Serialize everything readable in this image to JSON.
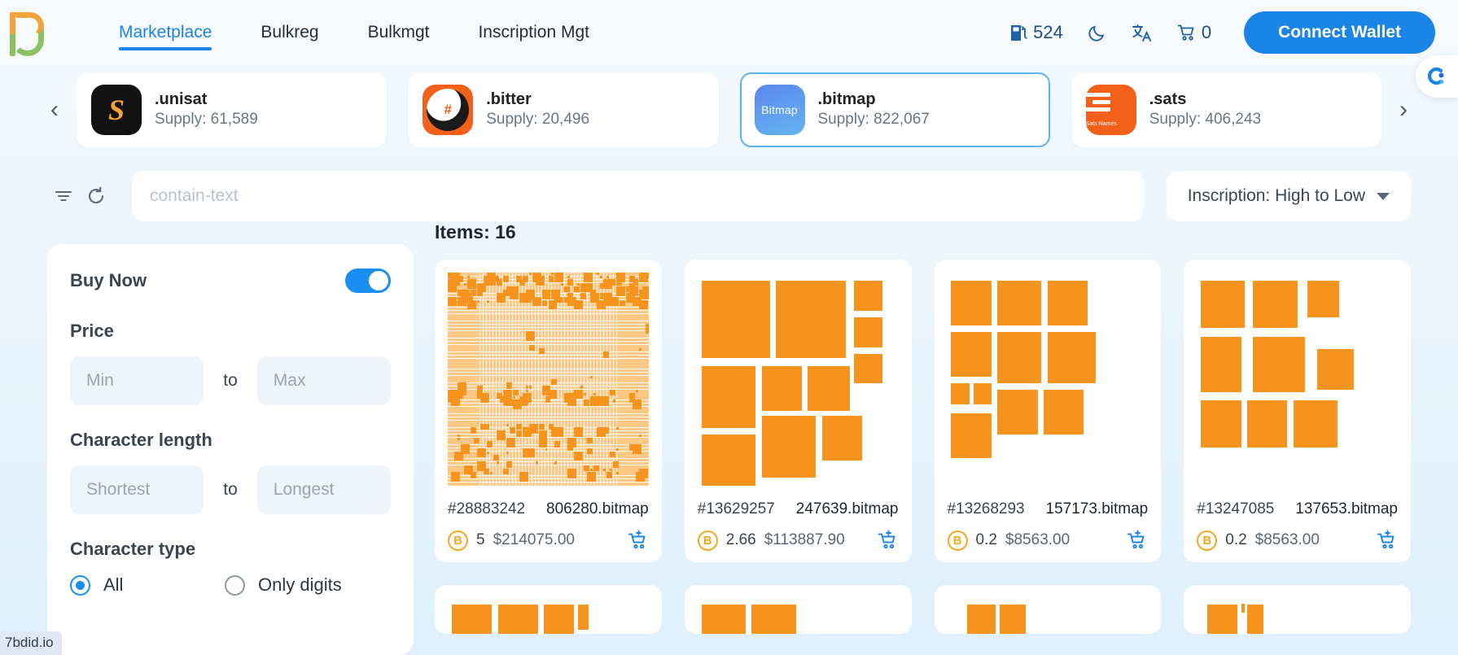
{
  "brand": {
    "logo_name": "bdid-logo"
  },
  "nav": {
    "items": [
      {
        "label": "Marketplace",
        "active": true
      },
      {
        "label": "Bulkreg",
        "active": false
      },
      {
        "label": "Bulkmgt",
        "active": false
      },
      {
        "label": "Inscription Mgt",
        "active": false
      }
    ]
  },
  "header_right": {
    "gas_icon": "gas-pump-icon",
    "gas_value": "524",
    "theme_icon": "moon-icon",
    "language_icon": "translate-icon",
    "cart_icon": "shopping-cart-icon",
    "cart_count": "0",
    "connect_label": "Connect Wallet"
  },
  "collections": {
    "prev_label": "‹",
    "next_label": "›",
    "items": [
      {
        "name": ".unisat",
        "supply": "Supply: 61,589",
        "selected": false,
        "logo": "unisat-logo"
      },
      {
        "name": ".bitter",
        "supply": "Supply: 20,496",
        "selected": false,
        "logo": "bitter-logo"
      },
      {
        "name": ".bitmap",
        "supply": "Supply: 822,067",
        "selected": true,
        "logo": "bitmap-logo"
      },
      {
        "name": ".sats",
        "supply": "Supply: 406,243",
        "selected": false,
        "logo": "sats-names-logo"
      }
    ]
  },
  "toolbar": {
    "filter_icon": "filter-icon",
    "refresh_icon": "refresh-icon",
    "search_placeholder": "contain-text",
    "search_value": "",
    "sort_label": "Inscription: High to Low"
  },
  "filters": {
    "buy_now_label": "Buy Now",
    "buy_now_on": true,
    "price_title": "Price",
    "price_min_placeholder": "Min",
    "price_max_placeholder": "Max",
    "price_min_value": "",
    "price_max_value": "",
    "to_label": "to",
    "char_length_title": "Character length",
    "length_min_placeholder": "Shortest",
    "length_max_placeholder": "Longest",
    "length_min_value": "",
    "length_max_value": "",
    "char_type_title": "Character type",
    "char_type_options": [
      {
        "label": "All",
        "checked": true
      },
      {
        "label": "Only digits",
        "checked": false
      }
    ]
  },
  "results": {
    "count_label": "Items: 16",
    "cards": [
      {
        "id": "#28883242",
        "name": "806280.bitmap",
        "btc": "5",
        "usd": "$214075.00",
        "cart_icon": "add-to-cart-icon"
      },
      {
        "id": "#13629257",
        "name": "247639.bitmap",
        "btc": "2.66",
        "usd": "$113887.90",
        "cart_icon": "add-to-cart-icon"
      },
      {
        "id": "#13268293",
        "name": "157173.bitmap",
        "btc": "0.2",
        "usd": "$8563.00",
        "cart_icon": "add-to-cart-icon"
      },
      {
        "id": "#13247085",
        "name": "137653.bitmap",
        "btc": "0.2",
        "usd": "$8563.00",
        "cart_icon": "add-to-cart-icon"
      }
    ]
  },
  "overlays": {
    "support_icon": "support-chat-icon",
    "status_link": "7bdid.io"
  },
  "colors": {
    "accent_blue": "#1b84e7",
    "tile_orange": "#f7941e",
    "tile_orange_light": "#fbbc6a",
    "btc_gold": "#f5a623",
    "page_bg_top": "#f5fafe",
    "page_bg_bottom": "#dff0fc"
  }
}
